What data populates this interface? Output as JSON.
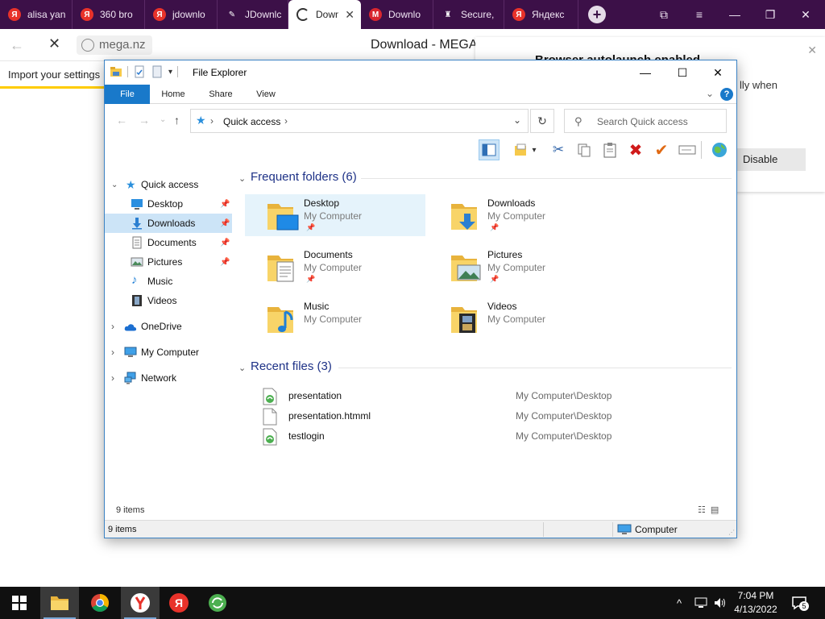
{
  "browser": {
    "tabs": [
      {
        "label": "alisa yan",
        "icon": "yandex-icon",
        "glyph": "Я"
      },
      {
        "label": "360 bro",
        "icon": "yandex-icon",
        "glyph": "Я"
      },
      {
        "label": "jdownlo",
        "icon": "yandex-icon",
        "glyph": "Я"
      },
      {
        "label": "JDownlc",
        "icon": "jdownloader-icon",
        "glyph": "✎"
      },
      {
        "label": "Down",
        "icon": "loading-spinner-icon",
        "glyph": ""
      },
      {
        "label": "Downlo",
        "icon": "mega-icon",
        "glyph": "M"
      },
      {
        "label": "Secure,",
        "icon": "brave-icon",
        "glyph": "♜"
      },
      {
        "label": "Яндекс",
        "icon": "yandex-icon",
        "glyph": "Я"
      }
    ],
    "new_tab_glyph": "+",
    "controls": {
      "pin": "⧉",
      "menu": "≡",
      "minimize": "—",
      "restore": "❐",
      "close": "✕"
    },
    "address": {
      "url": "mega.nz",
      "page_title": "Download - MEGA"
    },
    "back_glyph": "←",
    "stop_glyph": "✕"
  },
  "page": {
    "import_settings": "Import your settings",
    "notification": {
      "title": "Browser autolaunch enabled",
      "body": "lly when",
      "disable_label": "Disable",
      "close_glyph": "✕"
    }
  },
  "explorer": {
    "title": "File Explorer",
    "controls": {
      "minimize": "—",
      "maximize": "☐",
      "close": "✕"
    },
    "ribbon_tabs": [
      "File",
      "Home",
      "Share",
      "View"
    ],
    "help_glyph": "?",
    "ribbon_chevron": "⌄",
    "nav": {
      "back": "←",
      "forward": "→",
      "recent": "⌄",
      "up": "↑"
    },
    "address": {
      "location": "Quick access",
      "sep": "›",
      "dropdown": "⌄"
    },
    "refresh_glyph": "↻",
    "search_placeholder": "Search Quick access",
    "search_glyph": "⚲",
    "toolbar": {
      "cut": "✂",
      "copy": "⧉",
      "paste": "📋",
      "delete": "✖",
      "check": "✔",
      "rename": "▭",
      "globe": "●",
      "dropdown": "▾"
    },
    "navpane": {
      "quick_access": "Quick access",
      "pinned": [
        {
          "label": "Desktop"
        },
        {
          "label": "Downloads"
        },
        {
          "label": "Documents"
        },
        {
          "label": "Pictures"
        }
      ],
      "unpinned": [
        {
          "label": "Music"
        },
        {
          "label": "Videos"
        }
      ],
      "roots": [
        {
          "label": "OneDrive"
        },
        {
          "label": "My Computer"
        },
        {
          "label": "Network"
        }
      ],
      "expand_open": "⌄",
      "expand_closed": "›",
      "pin_glyph": "📌"
    },
    "frequent": {
      "header": "Frequent folders (6)",
      "folders": [
        {
          "name": "Desktop",
          "location": "My Computer"
        },
        {
          "name": "Downloads",
          "location": "My Computer"
        },
        {
          "name": "Documents",
          "location": "My Computer"
        },
        {
          "name": "Pictures",
          "location": "My Computer"
        },
        {
          "name": "Music",
          "location": "My Computer"
        },
        {
          "name": "Videos",
          "location": "My Computer"
        }
      ]
    },
    "recent": {
      "header": "Recent files (3)",
      "files": [
        {
          "name": "presentation",
          "path": "My Computer\\Desktop"
        },
        {
          "name": "presentation.htmml",
          "path": "My Computer\\Desktop"
        },
        {
          "name": "testlogin",
          "path": "My Computer\\Desktop"
        }
      ]
    },
    "status_count": "9 items",
    "status_bar_count": "9 items",
    "status_location": "Computer",
    "view_glyphs": "☷▤"
  },
  "taskbar": {
    "clock_time": "7:04 PM",
    "clock_date": "4/13/2022",
    "tray_chevron": "^",
    "notification_count": "5"
  },
  "colors": {
    "browser_tabstrip": "#3c1048",
    "explorer_accent": "#1979ca",
    "selection": "#cce4f7",
    "yandex_red": "#e8322a",
    "taskbar": "#101010"
  }
}
